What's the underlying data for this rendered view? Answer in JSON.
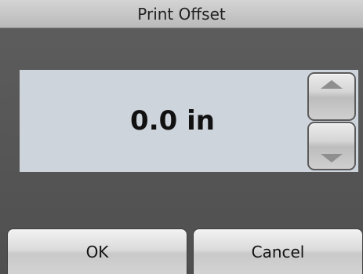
{
  "dialog": {
    "title": "Print Offset",
    "value": "0.0 in",
    "spinner": {
      "up_icon": "triangle-up-icon",
      "down_icon": "triangle-down-icon"
    },
    "buttons": {
      "ok_label": "OK",
      "cancel_label": "Cancel"
    }
  },
  "colors": {
    "title_bar": "#c8c8c8",
    "background": "#545454",
    "value_panel": "#cdd4dc"
  }
}
